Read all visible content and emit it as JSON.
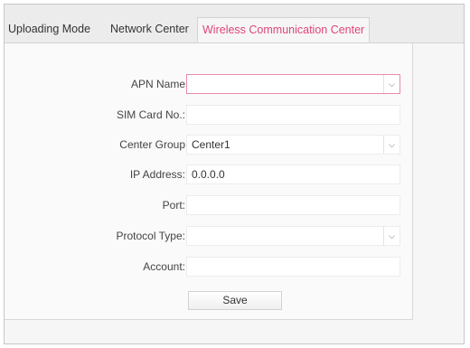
{
  "tabs": [
    {
      "label": "Uploading Mode",
      "active": false
    },
    {
      "label": "Network Center",
      "active": false
    },
    {
      "label": "Wireless Communication Center",
      "active": true
    }
  ],
  "form": {
    "apn_name": {
      "label": "APN Name",
      "value": ""
    },
    "sim_card": {
      "label": "SIM Card No.:",
      "value": ""
    },
    "center_group": {
      "label": "Center Group",
      "value": "Center1"
    },
    "ip_address": {
      "label": "IP Address:",
      "value": "0.0.0.0"
    },
    "port": {
      "label": "Port:",
      "value": ""
    },
    "protocol_type": {
      "label": "Protocol Type:",
      "value": ""
    },
    "account": {
      "label": "Account:",
      "value": ""
    }
  },
  "save_label": "Save",
  "icons": {
    "dropdown": "chevron-down-icon"
  },
  "colors": {
    "active_tab_text": "#e0457b",
    "focus_border": "#e88ca6"
  }
}
